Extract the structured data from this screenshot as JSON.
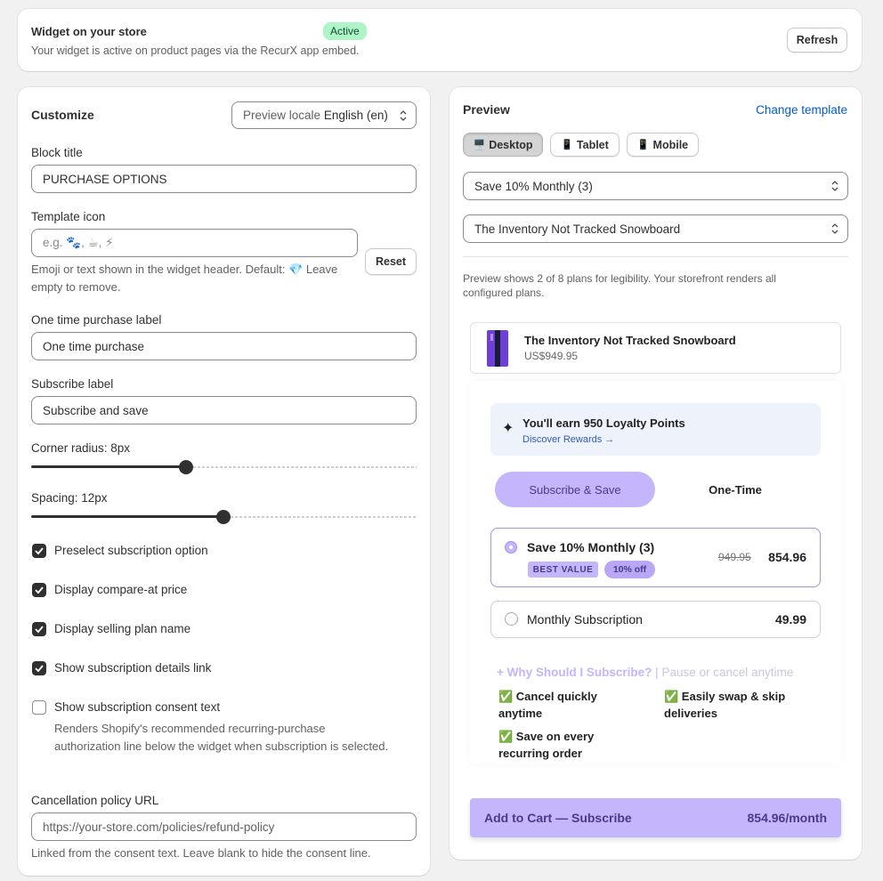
{
  "widget_card": {
    "title": "Widget on your store",
    "status_badge": "Active",
    "description": "Your widget is active on product pages via the RecurX app embed.",
    "refresh_button": "Refresh"
  },
  "customize": {
    "title": "Customize",
    "locale_select": {
      "label": "Preview locale",
      "value": "English (en)"
    },
    "block_title": {
      "label": "Block title",
      "value": "PURCHASE OPTIONS"
    },
    "template_icon": {
      "label": "Template icon",
      "placeholder": "e.g. 🐾, ☕, ⚡",
      "reset_button": "Reset",
      "help": "Emoji or text shown in the widget header. Default: 💎 Leave empty to remove."
    },
    "one_time_label": {
      "label": "One time purchase label",
      "value": "One time purchase"
    },
    "subscribe_label": {
      "label": "Subscribe label",
      "value": "Subscribe and save"
    },
    "corner_radius": {
      "label": "Corner radius: 8px",
      "value": 8
    },
    "spacing": {
      "label": "Spacing: 12px",
      "value": 12
    },
    "checkboxes": [
      {
        "label": "Preselect subscription option",
        "checked": true
      },
      {
        "label": "Display compare-at price",
        "checked": true
      },
      {
        "label": "Display selling plan name",
        "checked": true
      },
      {
        "label": "Show subscription details link",
        "checked": true
      },
      {
        "label": "Show subscription consent text",
        "checked": false
      }
    ],
    "consent_help": "Renders Shopify's recommended recurring-purchase authorization line below the widget when subscription is selected.",
    "cancellation_url": {
      "label": "Cancellation policy URL",
      "placeholder": "https://your-store.com/policies/refund-policy",
      "help": "Linked from the consent text. Leave blank to hide the consent line."
    }
  },
  "preview": {
    "title": "Preview",
    "change_template": "Change template",
    "devices": [
      {
        "icon": "🖥️",
        "label": "Desktop",
        "active": true
      },
      {
        "icon": "📱",
        "label": "Tablet",
        "active": false
      },
      {
        "icon": "📱",
        "label": "Mobile",
        "active": false
      }
    ],
    "plan_select": "Save 10% Monthly (3)",
    "product_select": "The Inventory Not Tracked Snowboard",
    "note": "Preview shows 2 of 8 plans for legibility. Your storefront renders all configured plans.",
    "product": {
      "name": "The Inventory Not Tracked Snowboard",
      "price": "US$949.95"
    },
    "loyalty": {
      "title": "You'll earn 950 Loyalty Points",
      "link": "Discover Rewards →"
    },
    "tabs": {
      "subscribe": "Subscribe & Save",
      "one_time": "One-Time"
    },
    "plans": [
      {
        "name": "Save 10% Monthly (3)",
        "badge1": "BEST VALUE",
        "badge2": "10% off",
        "compare_price": "949.95",
        "price": "854.96",
        "selected": true
      },
      {
        "name": "Monthly Subscription",
        "price": "49.99",
        "selected": false
      }
    ],
    "why_heading": "+ Why Should I Subscribe?",
    "why_sep": "|",
    "why_sub": "Pause or cancel anytime",
    "benefits": [
      "✅ Cancel quickly anytime",
      "✅ Easily swap & skip deliveries",
      "✅ Save on every recurring order"
    ],
    "add_to_cart": {
      "label": "Add to Cart — Subscribe",
      "price": "854.96/month"
    }
  },
  "colors": {
    "accent_purple": "#c4b5fd",
    "badge_purple": "#b9a6f5",
    "link_blue": "#005bd3",
    "active_green": "#aff4c6"
  }
}
